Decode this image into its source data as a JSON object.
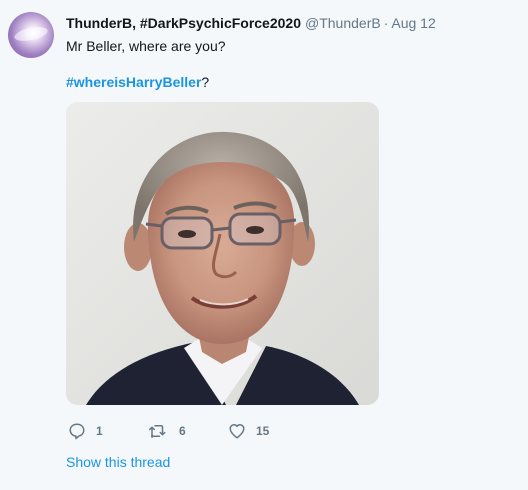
{
  "tweet": {
    "display_name": "ThunderB, #DarkPsychicForce2020",
    "handle": "@ThunderB",
    "separator": "·",
    "date": "Aug 12",
    "line1": "Mr Beller, where are you?",
    "hashtag": "#whereisHarryBeller",
    "hashtag_suffix": "?",
    "replies": "1",
    "retweets": "6",
    "likes": "15",
    "show_thread": "Show this thread"
  },
  "colors": {
    "link": "#1b95e0",
    "secondary_text": "#657786",
    "primary_text": "#14171a",
    "background": "#f5f8fa"
  },
  "icons": {
    "reply": "reply-icon",
    "retweet": "retweet-icon",
    "like": "heart-icon"
  }
}
